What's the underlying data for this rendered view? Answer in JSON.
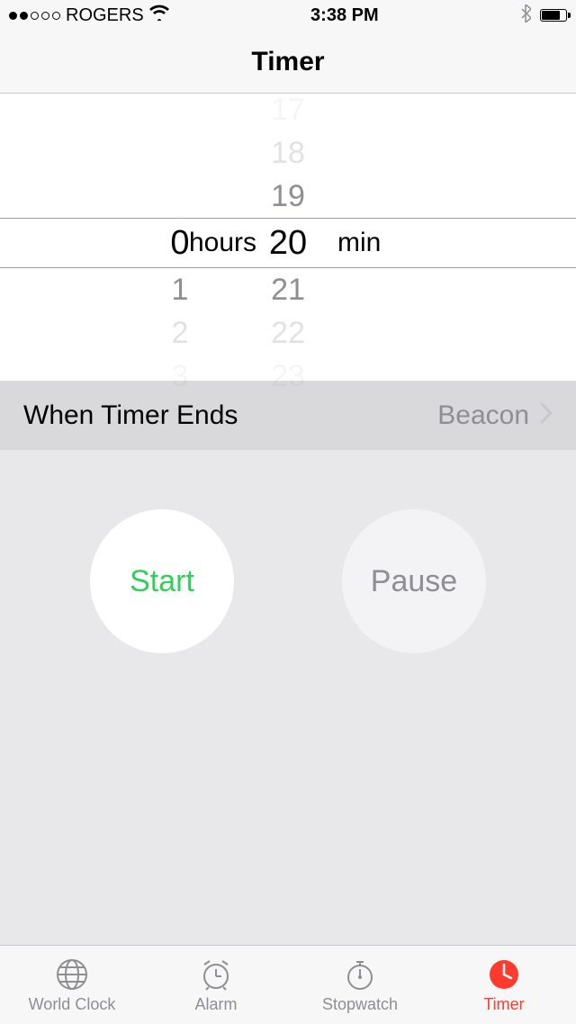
{
  "status": {
    "carrier": "ROGERS",
    "time": "3:38 PM"
  },
  "nav": {
    "title": "Timer"
  },
  "picker": {
    "hours": {
      "selected": "0",
      "label": "hours",
      "below": [
        "1",
        "2",
        "3"
      ]
    },
    "minutes": {
      "label": "min",
      "selected": "20",
      "above": [
        "17",
        "18",
        "19"
      ],
      "below": [
        "21",
        "22",
        "23"
      ]
    }
  },
  "ends_row": {
    "label": "When Timer Ends",
    "value": "Beacon"
  },
  "buttons": {
    "start": "Start",
    "pause": "Pause"
  },
  "tabs": {
    "world_clock": "World Clock",
    "alarm": "Alarm",
    "stopwatch": "Stopwatch",
    "timer": "Timer"
  }
}
